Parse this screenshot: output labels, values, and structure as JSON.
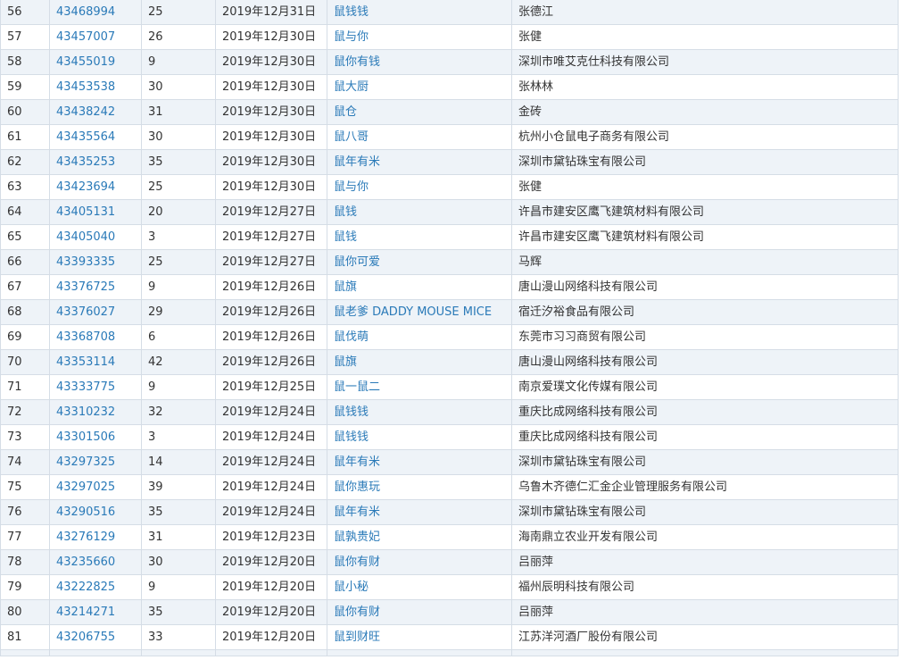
{
  "table": {
    "rows": [
      {
        "no": "56",
        "reg": "43468994",
        "cls": "25",
        "date": "2019年12月31日",
        "name": "鼠钱钱",
        "applicant": "张德江"
      },
      {
        "no": "57",
        "reg": "43457007",
        "cls": "26",
        "date": "2019年12月30日",
        "name": "鼠与你",
        "applicant": "张健"
      },
      {
        "no": "58",
        "reg": "43455019",
        "cls": "9",
        "date": "2019年12月30日",
        "name": "鼠你有钱",
        "applicant": "深圳市唯艾克仕科技有限公司"
      },
      {
        "no": "59",
        "reg": "43453538",
        "cls": "30",
        "date": "2019年12月30日",
        "name": "鼠大厨",
        "applicant": "张林林"
      },
      {
        "no": "60",
        "reg": "43438242",
        "cls": "31",
        "date": "2019年12月30日",
        "name": "鼠仓",
        "applicant": "金砖"
      },
      {
        "no": "61",
        "reg": "43435564",
        "cls": "30",
        "date": "2019年12月30日",
        "name": "鼠八哥",
        "applicant": "杭州小仓鼠电子商务有限公司"
      },
      {
        "no": "62",
        "reg": "43435253",
        "cls": "35",
        "date": "2019年12月30日",
        "name": "鼠年有米",
        "applicant": "深圳市黛钻珠宝有限公司"
      },
      {
        "no": "63",
        "reg": "43423694",
        "cls": "25",
        "date": "2019年12月30日",
        "name": "鼠与你",
        "applicant": "张健"
      },
      {
        "no": "64",
        "reg": "43405131",
        "cls": "20",
        "date": "2019年12月27日",
        "name": "鼠钱",
        "applicant": "许昌市建安区鹰飞建筑材料有限公司"
      },
      {
        "no": "65",
        "reg": "43405040",
        "cls": "3",
        "date": "2019年12月27日",
        "name": "鼠钱",
        "applicant": "许昌市建安区鹰飞建筑材料有限公司"
      },
      {
        "no": "66",
        "reg": "43393335",
        "cls": "25",
        "date": "2019年12月27日",
        "name": "鼠你可爱",
        "applicant": "马辉"
      },
      {
        "no": "67",
        "reg": "43376725",
        "cls": "9",
        "date": "2019年12月26日",
        "name": "鼠旗",
        "applicant": "唐山漫山网络科技有限公司"
      },
      {
        "no": "68",
        "reg": "43376027",
        "cls": "29",
        "date": "2019年12月26日",
        "name": "鼠老爹 DADDY MOUSE MICE",
        "applicant": "宿迁汐裕食品有限公司"
      },
      {
        "no": "69",
        "reg": "43368708",
        "cls": "6",
        "date": "2019年12月26日",
        "name": "鼠伐萌",
        "applicant": "东莞市习习商贸有限公司"
      },
      {
        "no": "70",
        "reg": "43353114",
        "cls": "42",
        "date": "2019年12月26日",
        "name": "鼠旗",
        "applicant": "唐山漫山网络科技有限公司"
      },
      {
        "no": "71",
        "reg": "43333775",
        "cls": "9",
        "date": "2019年12月25日",
        "name": "鼠一鼠二",
        "applicant": "南京爱璞文化传媒有限公司"
      },
      {
        "no": "72",
        "reg": "43310232",
        "cls": "32",
        "date": "2019年12月24日",
        "name": "鼠钱钱",
        "applicant": "重庆比成网络科技有限公司"
      },
      {
        "no": "73",
        "reg": "43301506",
        "cls": "3",
        "date": "2019年12月24日",
        "name": "鼠钱钱",
        "applicant": "重庆比成网络科技有限公司"
      },
      {
        "no": "74",
        "reg": "43297325",
        "cls": "14",
        "date": "2019年12月24日",
        "name": "鼠年有米",
        "applicant": "深圳市黛钻珠宝有限公司"
      },
      {
        "no": "75",
        "reg": "43297025",
        "cls": "39",
        "date": "2019年12月24日",
        "name": "鼠你惠玩",
        "applicant": "乌鲁木齐德仁汇金企业管理服务有限公司"
      },
      {
        "no": "76",
        "reg": "43290516",
        "cls": "35",
        "date": "2019年12月24日",
        "name": "鼠年有米",
        "applicant": "深圳市黛钻珠宝有限公司"
      },
      {
        "no": "77",
        "reg": "43276129",
        "cls": "31",
        "date": "2019年12月23日",
        "name": "鼠孰贵妃",
        "applicant": "海南鼎立农业开发有限公司"
      },
      {
        "no": "78",
        "reg": "43235660",
        "cls": "30",
        "date": "2019年12月20日",
        "name": "鼠你有财",
        "applicant": "吕丽萍"
      },
      {
        "no": "79",
        "reg": "43222825",
        "cls": "9",
        "date": "2019年12月20日",
        "name": "鼠小秘",
        "applicant": "福州辰明科技有限公司"
      },
      {
        "no": "80",
        "reg": "43214271",
        "cls": "35",
        "date": "2019年12月20日",
        "name": "鼠你有财",
        "applicant": "吕丽萍"
      },
      {
        "no": "81",
        "reg": "43206755",
        "cls": "33",
        "date": "2019年12月20日",
        "name": "鼠到财旺",
        "applicant": "江苏洋河酒厂股份有限公司"
      }
    ]
  },
  "colors": {
    "link": "#2a7ab8",
    "text": "#333333",
    "row_alt": "#eef3f8",
    "border": "#d5dde6"
  }
}
